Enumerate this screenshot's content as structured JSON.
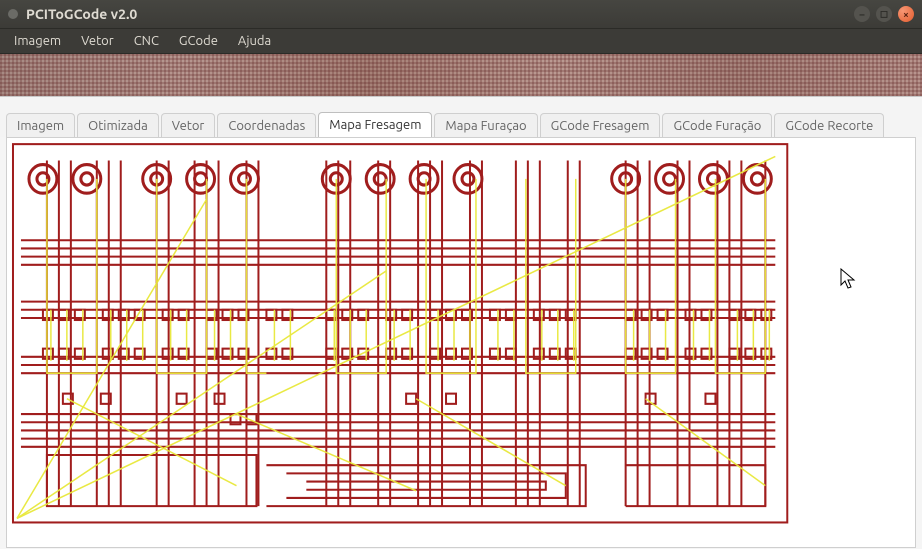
{
  "window": {
    "title": "PCIToGCode  v2.0"
  },
  "menu": {
    "items": [
      "Imagem",
      "Vetor",
      "CNC",
      "GCode",
      "Ajuda"
    ]
  },
  "tabs": {
    "active_index": 4,
    "items": [
      "Imagem",
      "Otimizada",
      "Vetor",
      "Coordenadas",
      "Mapa Fresagem",
      "Mapa Furaçao",
      "GCode Fresagem",
      "GCode Furação",
      "GCode Recorte"
    ]
  },
  "canvas": {
    "description": "milling-map-preview",
    "trace_color": "#a01d1d",
    "path_color": "#e8e83a",
    "background": "#ffffff"
  }
}
